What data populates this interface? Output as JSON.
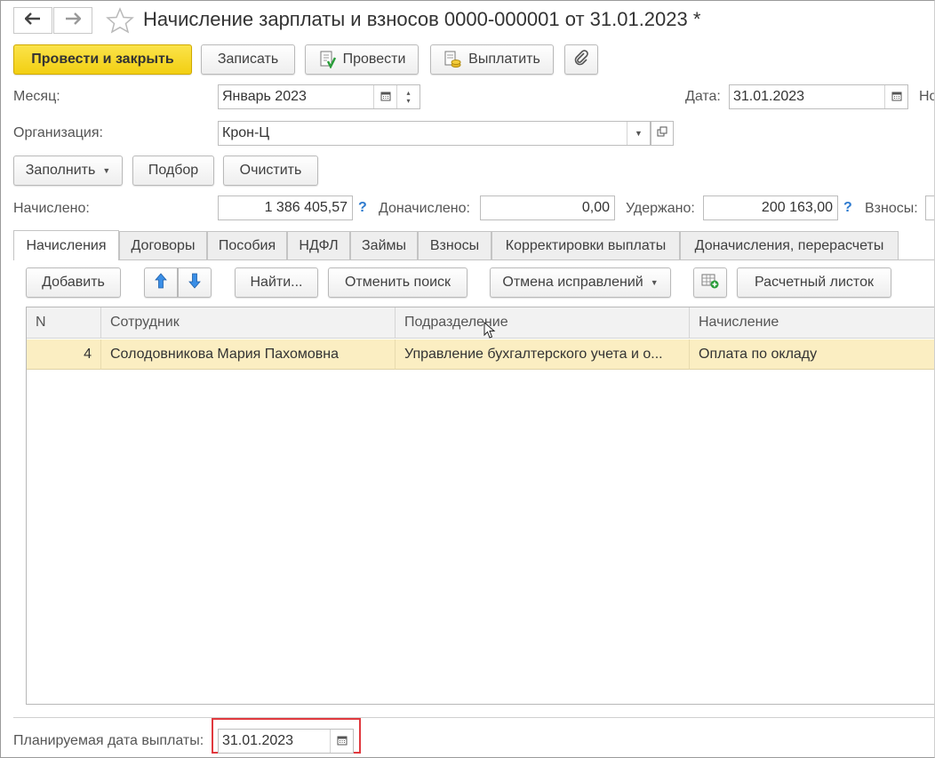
{
  "window": {
    "title": "Начисление зарплаты и взносов 0000-000001 от 31.01.2023 *"
  },
  "toolbar": {
    "post_close": "Провести и закрыть",
    "save": "Записать",
    "post": "Провести",
    "pay": "Выплатить"
  },
  "header": {
    "month_label": "Месяц:",
    "month_value": "Январь 2023",
    "date_label": "Дата:",
    "date_value": "31.01.2023",
    "number_label_partial": "Но",
    "org_label": "Организация:",
    "org_value": "Крон-Ц"
  },
  "actions": {
    "fill": "Заполнить",
    "select": "Подбор",
    "clear": "Очистить"
  },
  "totals": {
    "accrued_label": "Начислено:",
    "accrued_value": "1 386 405,57",
    "additional_label": "Доначислено:",
    "additional_value": "0,00",
    "withheld_label": "Удержано:",
    "withheld_value": "200 163,00",
    "contributions_label": "Взносы:",
    "help_mark": "?"
  },
  "tabs": [
    {
      "label": "Начисления",
      "active": true
    },
    {
      "label": "Договоры"
    },
    {
      "label": "Пособия"
    },
    {
      "label": "НДФЛ"
    },
    {
      "label": "Займы"
    },
    {
      "label": "Взносы"
    },
    {
      "label": "Корректировки выплаты"
    },
    {
      "label": "Доначисления, перерасчеты"
    }
  ],
  "table_toolbar": {
    "add": "Добавить",
    "find": "Найти...",
    "cancel_search": "Отменить поиск",
    "cancel_corrections": "Отмена исправлений",
    "payslip": "Расчетный листок"
  },
  "table": {
    "columns": [
      "N",
      "Сотрудник",
      "Подразделение",
      "Начисление"
    ],
    "rows": [
      {
        "n": "4",
        "employee": "Солодовникова Мария Пахомовна",
        "department": "Управление бухгалтерского учета и о...",
        "accrual": "Оплата по окладу"
      }
    ]
  },
  "footer": {
    "planned_date_label": "Планируемая дата выплаты:",
    "planned_date_value": "31.01.2023"
  },
  "colors": {
    "primary_button": "#f2cf12",
    "selected_row": "#fbeec2",
    "highlight_border": "#e0393e",
    "help": "#2e7bcf"
  }
}
